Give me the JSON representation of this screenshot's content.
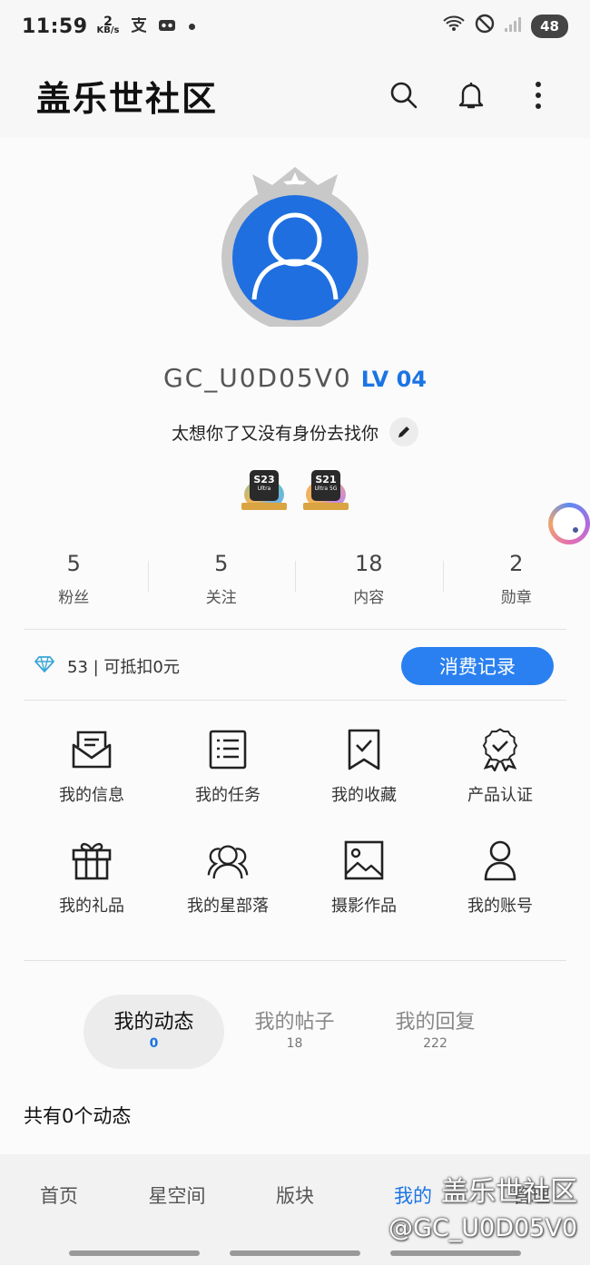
{
  "status_bar": {
    "time": "11:59",
    "net_speed_value": "2",
    "net_speed_unit": "KB/s",
    "battery": "48"
  },
  "app_bar": {
    "title": "盖乐世社区"
  },
  "profile": {
    "username": "GC_U0D05V0",
    "level": "LV 04",
    "signature": "太想你了又没有身份去找你",
    "badges": [
      {
        "model": "S23",
        "sub": "Ultra"
      },
      {
        "model": "S21",
        "sub": "Ultra 5G"
      }
    ]
  },
  "stats": [
    {
      "value": "5",
      "label": "粉丝"
    },
    {
      "value": "5",
      "label": "关注"
    },
    {
      "value": "18",
      "label": "内容"
    },
    {
      "value": "2",
      "label": "勋章"
    }
  ],
  "points": {
    "text": "53 | 可抵扣0元",
    "button": "消费记录"
  },
  "menu": [
    {
      "label": "我的信息",
      "icon": "message-envelope-icon"
    },
    {
      "label": "我的任务",
      "icon": "task-list-icon"
    },
    {
      "label": "我的收藏",
      "icon": "bookmark-check-icon"
    },
    {
      "label": "产品认证",
      "icon": "certified-badge-icon"
    },
    {
      "label": "我的礼品",
      "icon": "gift-icon"
    },
    {
      "label": "我的星部落",
      "icon": "tribe-group-icon"
    },
    {
      "label": "摄影作品",
      "icon": "photo-icon"
    },
    {
      "label": "我的账号",
      "icon": "account-person-icon"
    }
  ],
  "tabs": [
    {
      "label": "我的动态",
      "count": "0"
    },
    {
      "label": "我的帖子",
      "count": "18"
    },
    {
      "label": "我的回复",
      "count": "222"
    }
  ],
  "feed": {
    "count_text": "共有0个动态"
  },
  "bottom_nav": [
    {
      "label": "首页"
    },
    {
      "label": "星空间"
    },
    {
      "label": "版块"
    },
    {
      "label": "我的"
    },
    {
      "label": "管理"
    }
  ],
  "watermark": {
    "line1": "盖乐世社区",
    "line2": "@GC_U0D05V0"
  },
  "colors": {
    "accent": "#1b74e4",
    "button": "#2a80f0",
    "avatar_blue": "#1f6fe0",
    "frame_gray": "#c8c8c8"
  }
}
